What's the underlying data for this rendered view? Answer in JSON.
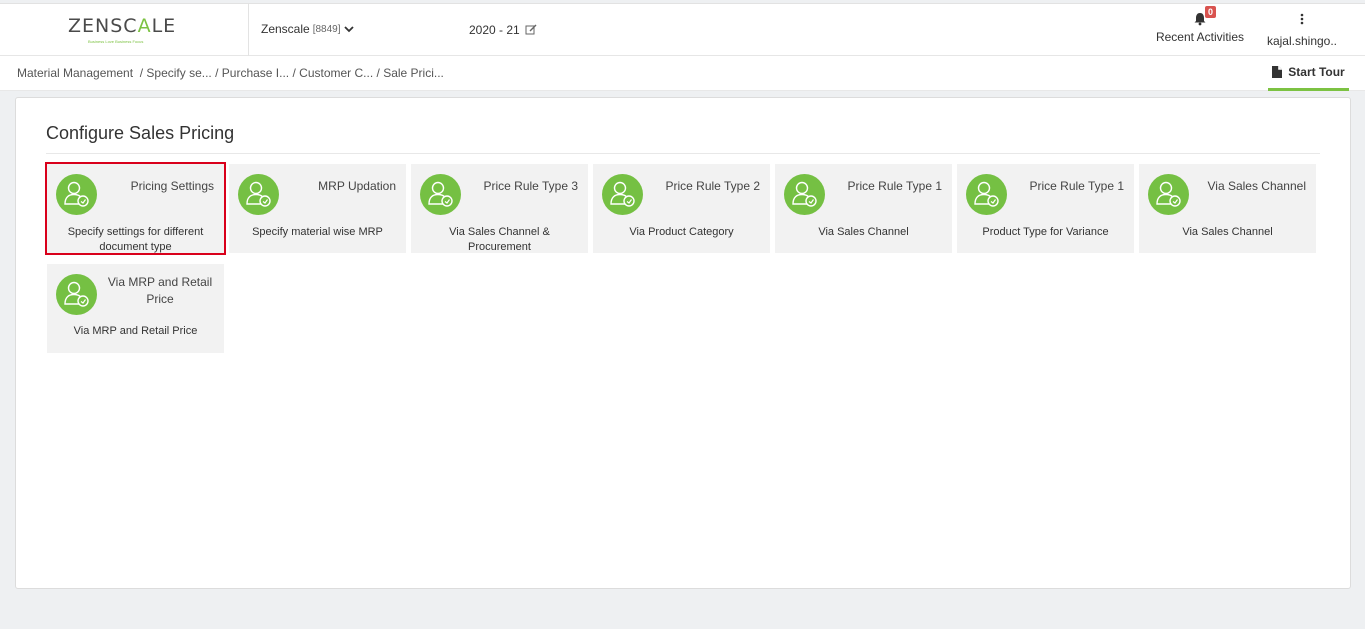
{
  "header": {
    "logo_dark": "ZENSC",
    "logo_green": "A",
    "logo_dark2": "LE",
    "logo_tagline": "Business Love Business Focus",
    "company_name": "Zenscale",
    "company_code": "[8849]",
    "fiscal_year": "2020 - 21",
    "notifications_count": "0",
    "recent_activities_label": "Recent Activities",
    "user_name": "kajal.shingo.."
  },
  "breadcrumb": {
    "items": [
      "Material Management",
      "/ Specify se...",
      "/ Purchase I...",
      "/ Customer C...",
      "/ Sale Prici..."
    ],
    "start_tour_label": "Start Tour"
  },
  "main": {
    "title": "Configure Sales Pricing",
    "cards": [
      {
        "title": "Pricing Settings",
        "description": "Specify settings for different document type",
        "selected": true
      },
      {
        "title": "MRP Updation",
        "description": "Specify material wise MRP"
      },
      {
        "title": "Price Rule Type 3",
        "description": "Via Sales Channel & Procurement"
      },
      {
        "title": "Price Rule Type 2",
        "description": "Via Product Category"
      },
      {
        "title": "Price Rule Type 1",
        "description": "Via Sales Channel"
      },
      {
        "title": "Price Rule Type 1",
        "description": "Product Type for Variance"
      },
      {
        "title": "Via Sales Channel",
        "description": "Via Sales Channel"
      },
      {
        "title": "Via MRP and Retail Price",
        "description": "Via MRP and Retail Price"
      }
    ]
  },
  "colors": {
    "accent_green": "#7cc242",
    "avatar_green": "#75c043",
    "selected_outline": "#d9001b",
    "badge_red": "#d9534f"
  }
}
